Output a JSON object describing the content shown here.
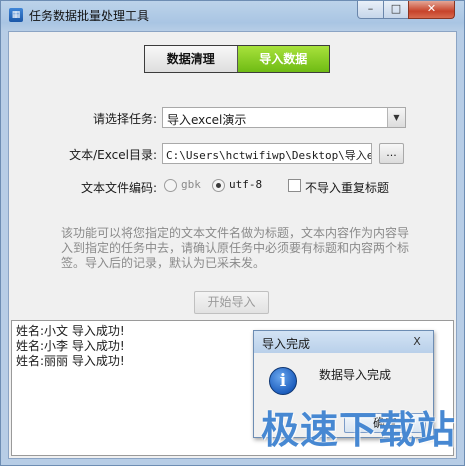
{
  "window": {
    "title": "任务数据批量处理工具",
    "icon": "app-icon",
    "controls": {
      "minimize": "–",
      "maximize": "□",
      "close": "✕"
    }
  },
  "tabs": [
    {
      "label": "数据清理",
      "active": false
    },
    {
      "label": "导入数据",
      "active": true
    }
  ],
  "form": {
    "task_label": "请选择任务:",
    "task_value": "导入excel演示",
    "dir_label": "文本/Excel目录:",
    "dir_value": "C:\\Users\\hctwifiwp\\Desktop\\导入exc",
    "browse_label": "...",
    "encoding_label": "文本文件编码:",
    "encoding_options": [
      {
        "label": "gbk",
        "checked": false
      },
      {
        "label": "utf-8",
        "checked": true
      }
    ],
    "no_dup_title_label": "不导入重复标题",
    "no_dup_title_checked": false
  },
  "description": "该功能可以将您指定的文本文件名做为标题，文本内容作为内容导入到指定的任务中去，请确认原任务中必须要有标题和内容两个标签。导入后的记录，默认为已采未发。",
  "start_button": "开始导入",
  "log": [
    "姓名:小文 导入成功!",
    "姓名:小李 导入成功!",
    "姓名:丽丽 导入成功!"
  ],
  "dialog": {
    "title": "导入完成",
    "close": "X",
    "message": "数据导入完成",
    "ok": "确定"
  },
  "watermark": "极速下载站",
  "colors": {
    "active_tab": "#7cc41e",
    "titlebar": "#b1cae6",
    "close_button": "#c7432a"
  }
}
